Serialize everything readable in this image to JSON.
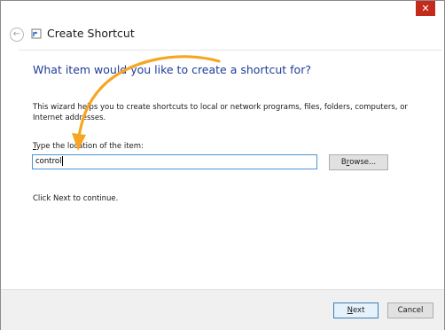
{
  "window": {
    "title": "Create Shortcut",
    "close_glyph": "✕",
    "back_glyph": "←",
    "close_color": "#c42b1c"
  },
  "icons": {
    "back": "back-arrow-icon",
    "shortcut": "shortcut-icon",
    "close": "close-icon"
  },
  "main": {
    "heading": "What item would you like to create a shortcut for?",
    "heading_color": "#1f3c9a",
    "intro": "This wizard helps you to create shortcuts to local or network programs, files, folders, computers, or Internet addresses.",
    "field_label_mnemonic": "T",
    "field_label_rest": "ype the location of the item:",
    "location_value": "control",
    "browse_mnemonic": "r",
    "browse_pre": "B",
    "browse_post": "owse...",
    "continue_text": "Click Next to continue."
  },
  "footer": {
    "next_mnemonic": "N",
    "next_rest": "ext",
    "cancel_label": "Cancel"
  },
  "annotation": {
    "arrow_color": "#f5a623"
  }
}
